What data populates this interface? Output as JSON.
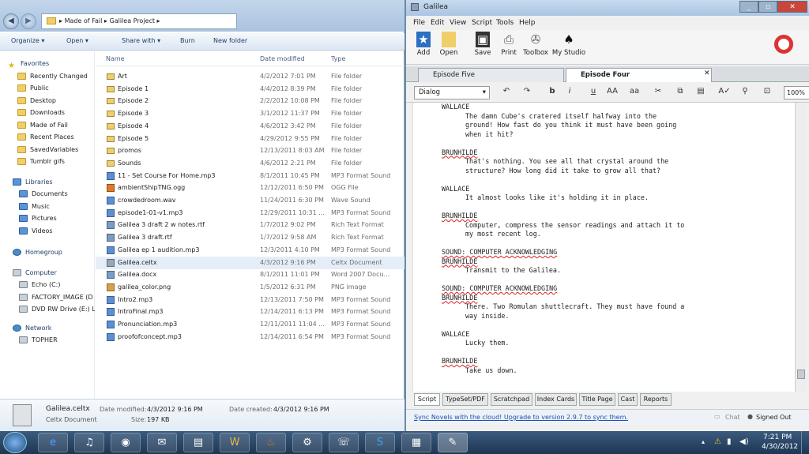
{
  "explorer": {
    "breadcrumb": [
      "Made of Fail",
      "Galilea Project"
    ],
    "toolbar": {
      "organize": "Organize ▾",
      "open": "Open ▾",
      "share": "Share with ▾",
      "burn": "Burn",
      "new_folder": "New folder"
    },
    "columns": {
      "name": "Name",
      "date": "Date modified",
      "type": "Type"
    },
    "nav": {
      "favorites_header": "Favorites",
      "favorites": [
        "Recently Changed",
        "Public",
        "Desktop",
        "Downloads",
        "Made of Fail",
        "Recent Places",
        "SavedVariables",
        "Tumblr gifs"
      ],
      "libraries_header": "Libraries",
      "libraries": [
        "Documents",
        "Music",
        "Pictures",
        "Videos"
      ],
      "homegroup": "Homegroup",
      "computer_header": "Computer",
      "computer": [
        "Echo (C:)",
        "FACTORY_IMAGE (D",
        "DVD RW Drive (E:) Li"
      ],
      "network_header": "Network",
      "network": [
        "TOPHER"
      ]
    },
    "files": [
      {
        "name": "Art",
        "date": "4/2/2012 7:01 PM",
        "type": "File folder",
        "icon": "folder"
      },
      {
        "name": "Episode 1",
        "date": "4/4/2012 8:39 PM",
        "type": "File folder",
        "icon": "folder"
      },
      {
        "name": "Episode 2",
        "date": "2/2/2012 10:08 PM",
        "type": "File folder",
        "icon": "folder"
      },
      {
        "name": "Episode 3",
        "date": "3/1/2012 11:37 PM",
        "type": "File folder",
        "icon": "folder"
      },
      {
        "name": "Episode 4",
        "date": "4/6/2012 3:42 PM",
        "type": "File folder",
        "icon": "folder"
      },
      {
        "name": "Episode 5",
        "date": "4/29/2012 9:55 PM",
        "type": "File folder",
        "icon": "folder"
      },
      {
        "name": "promos",
        "date": "12/13/2011 8:03 AM",
        "type": "File folder",
        "icon": "folder"
      },
      {
        "name": "Sounds",
        "date": "4/6/2012 2:21 PM",
        "type": "File folder",
        "icon": "folder"
      },
      {
        "name": "11 - Set Course For Home.mp3",
        "date": "8/1/2011 10:45 PM",
        "type": "MP3 Format Sound",
        "icon": "audio"
      },
      {
        "name": "ambientShipTNG.ogg",
        "date": "12/12/2011 6:50 PM",
        "type": "OGG File",
        "icon": "ogg"
      },
      {
        "name": "crowdedroom.wav",
        "date": "11/24/2011 6:30 PM",
        "type": "Wave Sound",
        "icon": "audio"
      },
      {
        "name": "episode1-01-v1.mp3",
        "date": "12/29/2011 10:31 ...",
        "type": "MP3 Format Sound",
        "icon": "audio"
      },
      {
        "name": "Galilea 3 draft 2 w notes.rtf",
        "date": "1/7/2012 9:02 PM",
        "type": "Rich Text Format",
        "icon": "doc"
      },
      {
        "name": "Galilea 3 draft.rtf",
        "date": "1/7/2012 9:58 AM",
        "type": "Rich Text Format",
        "icon": "doc"
      },
      {
        "name": "Galilea ep 1 audition.mp3",
        "date": "12/3/2011 4:10 PM",
        "type": "MP3 Format Sound",
        "icon": "audio"
      },
      {
        "name": "Galilea.celtx",
        "date": "4/3/2012 9:16 PM",
        "type": "Celtx Document",
        "icon": "celtx",
        "selected": true
      },
      {
        "name": "Galilea.docx",
        "date": "8/1/2011 11:01 PM",
        "type": "Word 2007 Docu...",
        "icon": "doc"
      },
      {
        "name": "galilea_color.png",
        "date": "1/5/2012 6:31 PM",
        "type": "PNG image",
        "icon": "image"
      },
      {
        "name": "Intro2.mp3",
        "date": "12/13/2011 7:50 PM",
        "type": "MP3 Format Sound",
        "icon": "audio"
      },
      {
        "name": "IntroFinal.mp3",
        "date": "12/14/2011 6:13 PM",
        "type": "MP3 Format Sound",
        "icon": "audio"
      },
      {
        "name": "Pronunciation.mp3",
        "date": "12/11/2011 11:04 ...",
        "type": "MP3 Format Sound",
        "icon": "audio"
      },
      {
        "name": "proofofconcept.mp3",
        "date": "12/14/2011 6:54 PM",
        "type": "MP3 Format Sound",
        "icon": "audio"
      }
    ],
    "details": {
      "filename": "Galilea.celtx",
      "filetype": "Celtx Document",
      "modified_label": "Date modified:",
      "modified": "4/3/2012 9:16 PM",
      "created_label": "Date created:",
      "created": "4/3/2012 9:16 PM",
      "size_label": "Size:",
      "size": "197 KB"
    }
  },
  "celtx": {
    "title": "Galilea",
    "menu": [
      "File",
      "Edit",
      "View",
      "Script",
      "Tools",
      "Help"
    ],
    "tools": [
      "Add",
      "Open",
      "Save",
      "Print",
      "Toolbox",
      "My Studio"
    ],
    "tabs": [
      "Episode Five",
      "Episode Four"
    ],
    "style_select": "Dialog",
    "zoom": "100%",
    "script": [
      {
        "t": "char",
        "text": "WALLACE"
      },
      {
        "t": "dia",
        "lines": [
          "The damn Cube's cratered itself halfway into the",
          "ground! How fast do you think it must have been going",
          "when it hit?"
        ]
      },
      {
        "t": "char",
        "text": "BRUNHILDE"
      },
      {
        "t": "dia",
        "lines": [
          "That's nothing. You see all that crystal around the",
          "structure? How long did it take to grow all that?"
        ]
      },
      {
        "t": "char",
        "text": "WALLACE"
      },
      {
        "t": "dia",
        "lines": [
          "It almost looks like it's holding it in place."
        ]
      },
      {
        "t": "char",
        "text": "BRUNHILDE"
      },
      {
        "t": "dia",
        "lines": [
          "Computer, compress the sensor readings and attach it to",
          "my most recent log."
        ]
      },
      {
        "t": "action",
        "text": "SOUND: COMPUTER ACKNOWLEDGING"
      },
      {
        "t": "char",
        "text": "BRUNHILDE"
      },
      {
        "t": "dia",
        "lines": [
          "Transmit to the Galilea."
        ]
      },
      {
        "t": "action",
        "text": "SOUND: COMPUTER ACKNOWLEDGING"
      },
      {
        "t": "char",
        "text": "BRUNHILDE"
      },
      {
        "t": "dia",
        "lines": [
          "There. Two Romulan shuttlecraft. They must have found a",
          "way inside."
        ]
      },
      {
        "t": "char",
        "text": "WALLACE"
      },
      {
        "t": "dia",
        "lines": [
          "Lucky them."
        ]
      },
      {
        "t": "char",
        "text": "BRUNHILDE"
      },
      {
        "t": "dia",
        "lines": [
          "Take us down."
        ]
      }
    ],
    "bottom_tabs": [
      "Script",
      "TypeSet/PDF",
      "Scratchpad",
      "Index Cards",
      "Title Page",
      "Cast",
      "Reports"
    ],
    "status_link": "Sync Novels with the cloud! Upgrade to version 2.9.7 to sync them.",
    "chat": "Chat",
    "signed_out": "Signed Out"
  },
  "taskbar": {
    "time": "7:21 PM",
    "date": "4/30/2012"
  }
}
